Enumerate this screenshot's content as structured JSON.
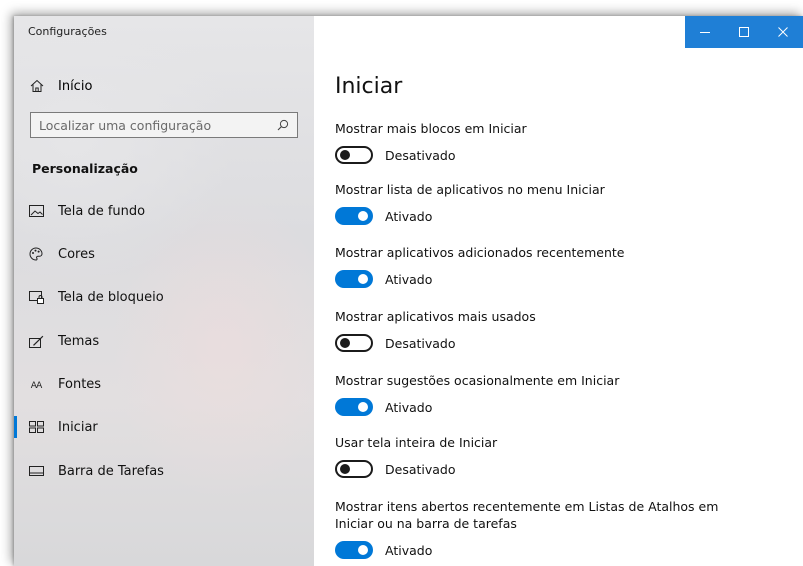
{
  "window": {
    "title": "Configurações"
  },
  "sidebar": {
    "home_label": "Início",
    "search_placeholder": "Localizar uma configuração",
    "section_title": "Personalização",
    "items": [
      {
        "label": "Tela de fundo",
        "icon": "picture-icon"
      },
      {
        "label": "Cores",
        "icon": "palette-icon"
      },
      {
        "label": "Tela de bloqueio",
        "icon": "lock-screen-icon"
      },
      {
        "label": "Temas",
        "icon": "brush-icon"
      },
      {
        "label": "Fontes",
        "icon": "font-icon",
        "glyph": "AA"
      },
      {
        "label": "Iniciar",
        "icon": "start-icon",
        "selected": true
      },
      {
        "label": "Barra de Tarefas",
        "icon": "taskbar-icon"
      }
    ]
  },
  "main": {
    "title": "Iniciar",
    "settings": [
      {
        "label": "Mostrar mais blocos em Iniciar",
        "on": false,
        "state": "Desativado"
      },
      {
        "label": "Mostrar lista de aplicativos no menu Iniciar",
        "on": true,
        "state": "Ativado"
      },
      {
        "label": "Mostrar aplicativos adicionados recentemente",
        "on": true,
        "state": "Ativado"
      },
      {
        "label": "Mostrar aplicativos mais usados",
        "on": false,
        "state": "Desativado"
      },
      {
        "label": "Mostrar sugestões ocasionalmente em Iniciar",
        "on": true,
        "state": "Ativado"
      },
      {
        "label": "Usar tela inteira de Iniciar",
        "on": false,
        "state": "Desativado"
      },
      {
        "label": "Mostrar itens abertos recentemente em Listas de Atalhos em Iniciar ou na barra de tarefas",
        "on": true,
        "state": "Ativado"
      }
    ]
  },
  "colors": {
    "accent": "#0078d7",
    "titlebar": "#1f7fd6"
  }
}
